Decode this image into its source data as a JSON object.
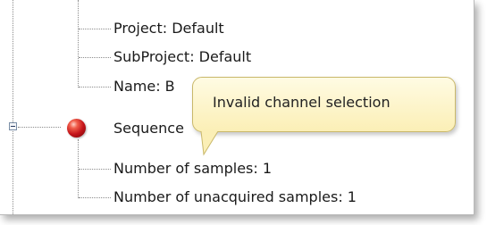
{
  "tree": {
    "project_line": "Project:  Default",
    "subproject_line": "SubProject: Default",
    "name_line": "Name: B",
    "sequence_label": "Sequence",
    "samples_line": "Number of samples: 1",
    "unacquired_line": "Number of unacquired samples: 1"
  },
  "tooltip": {
    "text": "Invalid channel selection"
  },
  "colors": {
    "tooltip_bg": "#fbefb6",
    "status_ball": "#c4141a",
    "tree_lines": "#8c8c8c"
  }
}
